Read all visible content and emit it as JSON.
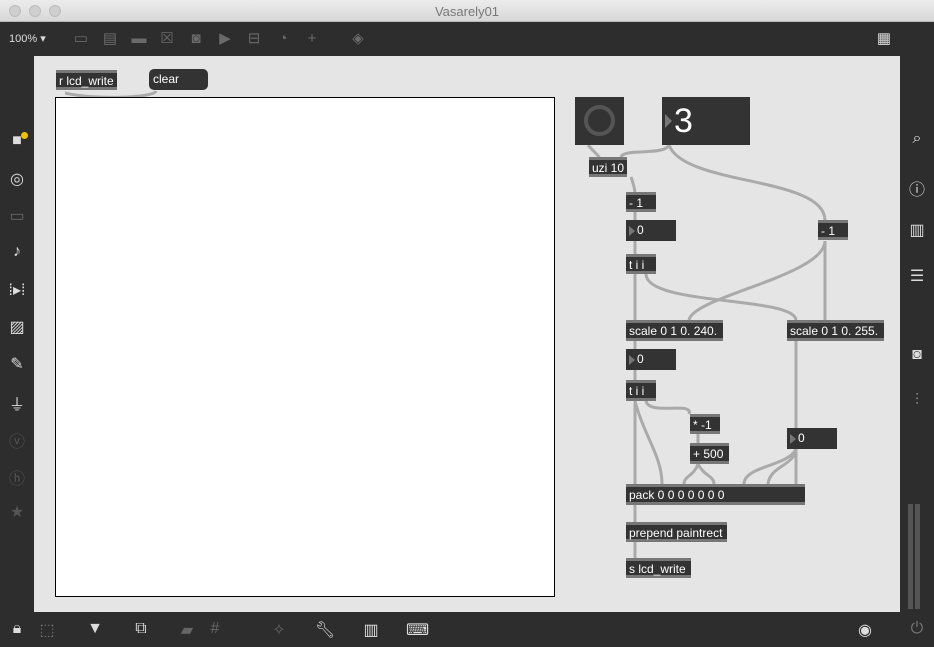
{
  "window": {
    "title": "Vasarely01"
  },
  "toolbar": {
    "zoom": "100%",
    "icons": [
      "presentation-icon",
      "comment-icon",
      "message-icon",
      "toggle-icon",
      "button-icon",
      "play-icon",
      "slider-icon",
      "dial-icon",
      "add-icon",
      "paint-bucket-icon"
    ]
  },
  "patch": {
    "receive": "r lcd_write",
    "clear": "clear",
    "big_number": "3",
    "uzi": "uzi 10",
    "minus1": "- 1",
    "num1": "0",
    "trig1": "t i i",
    "minus1b": "- 1",
    "scale1": "scale 0 1 0. 240.",
    "scale2": "scale 0 1 0. 255.",
    "num2": "0",
    "trig2": "t i i",
    "times": "* -1",
    "plus": "+ 500",
    "num3": "0",
    "pack": "pack 0 0 0 0 0 0 0",
    "prepend": "prepend paintrect",
    "send": "s lcd_write"
  }
}
